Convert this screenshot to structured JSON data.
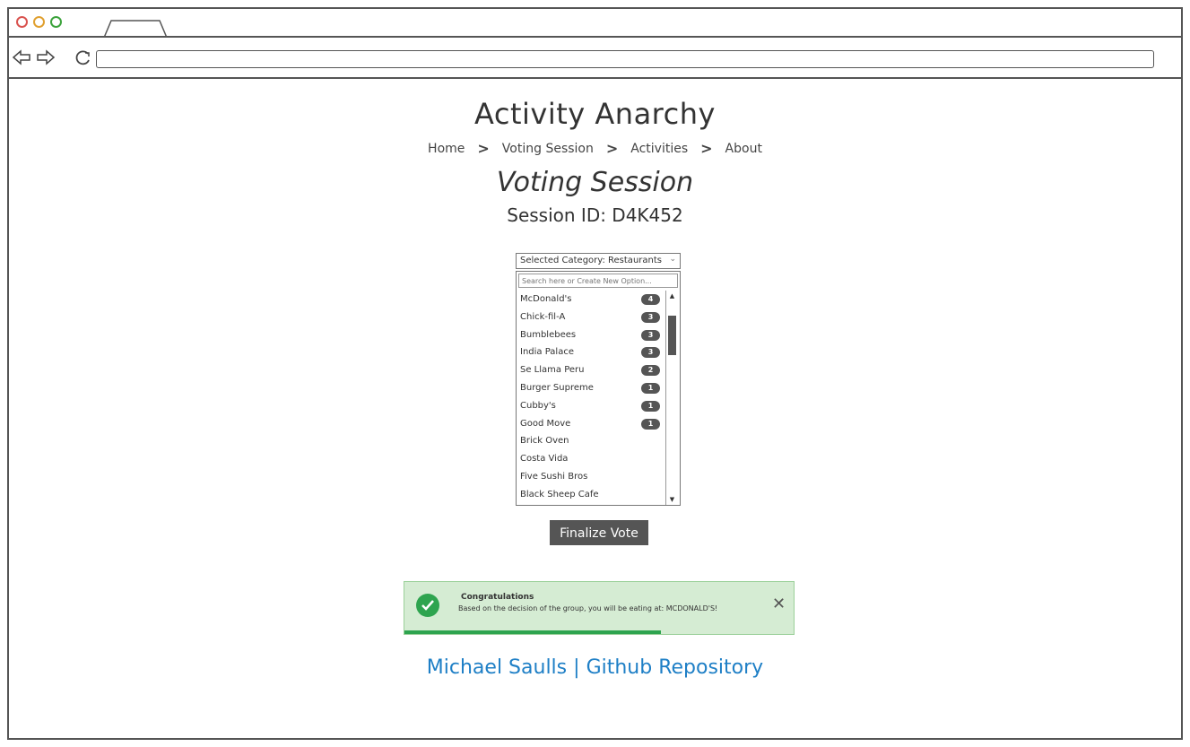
{
  "browser": {
    "url": ""
  },
  "header": {
    "app_title": "Activity Anarchy",
    "breadcrumb": [
      {
        "label": "Home"
      },
      {
        "label": "Voting Session"
      },
      {
        "label": "Activities"
      },
      {
        "label": "About"
      }
    ],
    "separator": ">"
  },
  "session": {
    "page_title": "Voting Session",
    "session_id_text": "Session ID: D4K452"
  },
  "category_select": {
    "selected_label": "Selected Category: Restaurants"
  },
  "options_panel": {
    "search_placeholder": "Search here or Create New Option...",
    "options": [
      {
        "name": "McDonald's",
        "votes": "4"
      },
      {
        "name": "Chick-fil-A",
        "votes": "3"
      },
      {
        "name": "Bumblebees",
        "votes": "3"
      },
      {
        "name": "India Palace",
        "votes": "3"
      },
      {
        "name": "Se Llama Peru",
        "votes": "2"
      },
      {
        "name": "Burger Supreme",
        "votes": "1"
      },
      {
        "name": "Cubby's",
        "votes": "1"
      },
      {
        "name": "Good Move",
        "votes": "1"
      },
      {
        "name": "Brick Oven",
        "votes": ""
      },
      {
        "name": "Costa Vida",
        "votes": ""
      },
      {
        "name": "Five Sushi Bros",
        "votes": ""
      },
      {
        "name": "Black Sheep Cafe",
        "votes": ""
      }
    ]
  },
  "actions": {
    "finalize_label": "Finalize Vote"
  },
  "toast": {
    "title": "Congratulations",
    "message": "Based on the decision of the group, you will be eating at: MCDONALD'S!",
    "close_glyph": "✕",
    "progress_fraction": 0.66,
    "color": "#2ea44f"
  },
  "footer": {
    "author": "Michael Saulls",
    "divider": "|",
    "repo_link": "Github Repository",
    "link_color": "#1e7fc6"
  }
}
